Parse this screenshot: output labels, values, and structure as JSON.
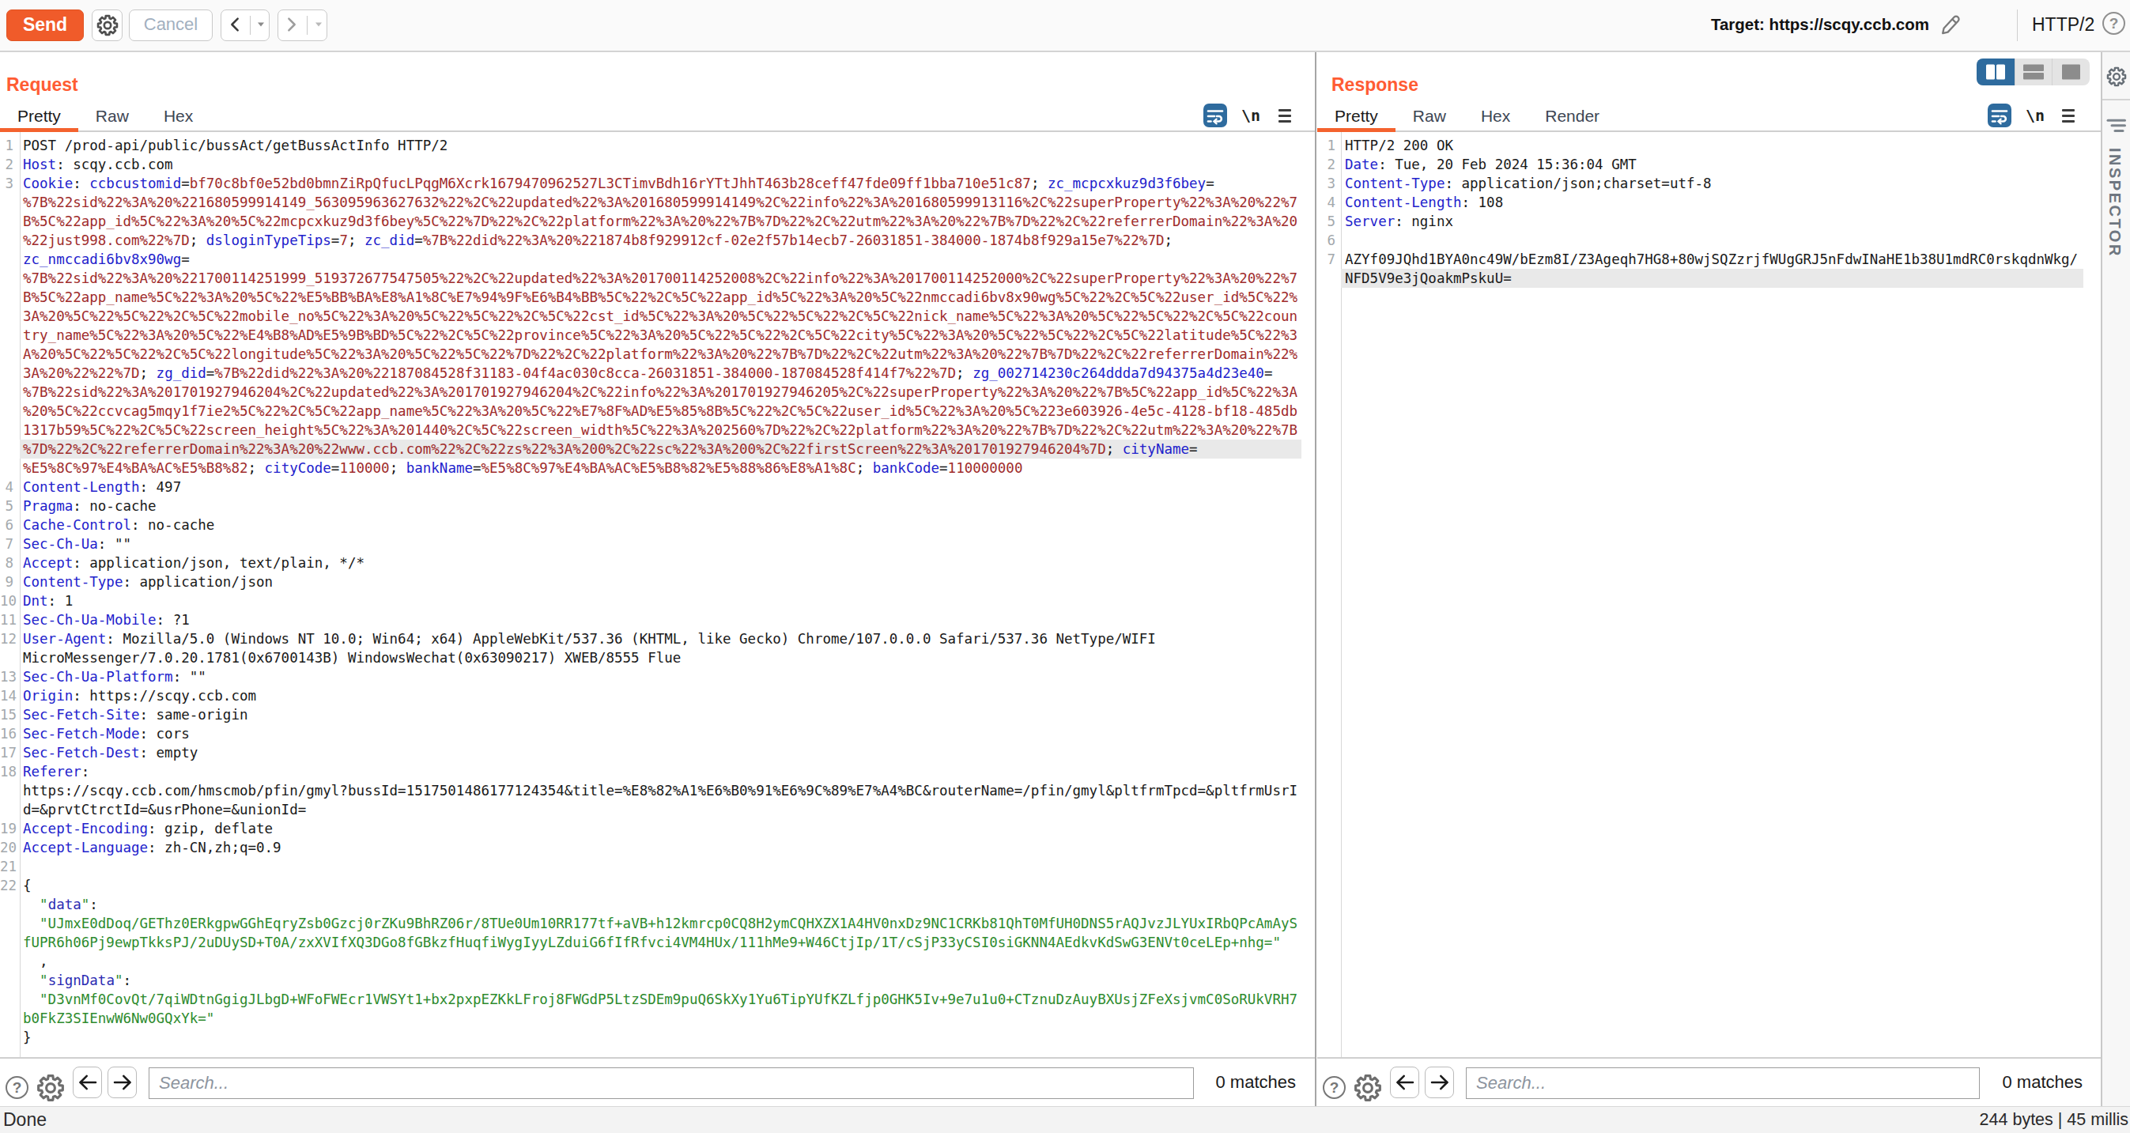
{
  "toolbar": {
    "send_label": "Send",
    "cancel_label": "Cancel",
    "target_label": "Target:",
    "target_url": "https://scqy.ccb.com",
    "protocol": "HTTP/2"
  },
  "request": {
    "title": "Request",
    "tabs": [
      "Pretty",
      "Raw",
      "Hex"
    ],
    "active_tab": "Pretty",
    "newline_label": "\\n",
    "search_placeholder": "Search...",
    "match_count": "0 matches",
    "rows": [
      {
        "n": "1",
        "s": [
          [
            "k",
            "POST /prod-api/public/bussAct/getBussActInfo HTTP/2"
          ]
        ]
      },
      {
        "n": "2",
        "s": [
          [
            "b",
            "Host"
          ],
          [
            "k",
            ": scqy.ccb.com"
          ]
        ]
      },
      {
        "n": "3",
        "s": [
          [
            "b",
            "Cookie"
          ],
          [
            "k",
            ": "
          ],
          [
            "b",
            "ccbcustomid"
          ],
          [
            "k",
            "="
          ],
          [
            "r",
            "bf70c8bf0e52bd0bmnZiRpQfucLPqgM6Xcrk1679470962527L3CTimvBdh16rYTtJhhT463b28ceff47fde09ff1bba710e51c87"
          ],
          [
            "k",
            "; "
          ],
          [
            "b",
            "zc_mcpcxkuz9d3f6bey"
          ],
          [
            "k",
            "="
          ]
        ]
      },
      {
        "s": [
          [
            "r",
            "%7B%22sid%22%3A%20%221680599914149_563095963627632%22%2C%22updated%22%3A%201680599914149%2C%22info%22%3A%201680599913116%2C%22superProperty%22%3A%20%22%7"
          ]
        ]
      },
      {
        "s": [
          [
            "r",
            "B%5C%22app_id%5C%22%3A%20%5C%22mcpcxkuz9d3f6bey%5C%22%7D%22%2C%22platform%22%3A%20%22%7B%7D%22%2C%22utm%22%3A%20%22%7B%7D%22%2C%22referrerDomain%22%3A%20"
          ]
        ]
      },
      {
        "s": [
          [
            "r",
            "%22just998.com%22%7D"
          ],
          [
            "k",
            "; "
          ],
          [
            "b",
            "dsloginTypeTips"
          ],
          [
            "k",
            "="
          ],
          [
            "r",
            "7"
          ],
          [
            "k",
            "; "
          ],
          [
            "b",
            "zc_did"
          ],
          [
            "k",
            "="
          ],
          [
            "r",
            "%7B%22did%22%3A%20%221874b8f929912cf-02e2f57b14ecb7-26031851-384000-1874b8f929a15e7%22%7D"
          ],
          [
            "k",
            ";"
          ]
        ]
      },
      {
        "s": [
          [
            "b",
            "zc_nmccadi6bv8x90wg"
          ],
          [
            "k",
            "="
          ]
        ]
      },
      {
        "s": [
          [
            "r",
            "%7B%22sid%22%3A%20%221700114251999_519372677547505%22%2C%22updated%22%3A%201700114252008%2C%22info%22%3A%201700114252000%2C%22superProperty%22%3A%20%22%7"
          ]
        ]
      },
      {
        "s": [
          [
            "r",
            "B%5C%22app_name%5C%22%3A%20%5C%22%E5%BB%BA%E8%A1%8C%E7%94%9F%E6%B4%BB%5C%22%2C%5C%22app_id%5C%22%3A%20%5C%22nmccadi6bv8x90wg%5C%22%2C%5C%22user_id%5C%22%"
          ]
        ]
      },
      {
        "s": [
          [
            "r",
            "3A%20%5C%22%5C%22%2C%5C%22mobile_no%5C%22%3A%20%5C%22%5C%22%2C%5C%22cst_id%5C%22%3A%20%5C%22%5C%22%2C%5C%22nick_name%5C%22%3A%20%5C%22%5C%22%2C%5C%22coun"
          ]
        ]
      },
      {
        "s": [
          [
            "r",
            "try_name%5C%22%3A%20%5C%22%E4%B8%AD%E5%9B%BD%5C%22%2C%5C%22province%5C%22%3A%20%5C%22%5C%22%2C%5C%22city%5C%22%3A%20%5C%22%5C%22%2C%5C%22latitude%5C%22%3"
          ]
        ]
      },
      {
        "s": [
          [
            "r",
            "A%20%5C%22%5C%22%2C%5C%22longitude%5C%22%3A%20%5C%22%5C%22%7D%22%2C%22platform%22%3A%20%22%7B%7D%22%2C%22utm%22%3A%20%22%7B%7D%22%2C%22referrerDomain%22%"
          ]
        ]
      },
      {
        "s": [
          [
            "r",
            "3A%20%22%22%7D"
          ],
          [
            "k",
            "; "
          ],
          [
            "b",
            "zg_did"
          ],
          [
            "k",
            "="
          ],
          [
            "r",
            "%7B%22did%22%3A%20%22187084528f31183-04f4ac030c8cca-26031851-384000-187084528f414f7%22%7D"
          ],
          [
            "k",
            "; "
          ],
          [
            "b",
            "zg_002714230c264ddda7d94375a4d23e40"
          ],
          [
            "k",
            "="
          ]
        ]
      },
      {
        "s": [
          [
            "r",
            "%7B%22sid%22%3A%201701927946204%2C%22updated%22%3A%201701927946204%2C%22info%22%3A%201701927946205%2C%22superProperty%22%3A%20%22%7B%5C%22app_id%5C%22%3A"
          ]
        ]
      },
      {
        "s": [
          [
            "r",
            "%20%5C%22ccvcag5mqy1f7ie2%5C%22%2C%5C%22app_name%5C%22%3A%20%5C%22%E7%8F%AD%E5%85%8B%5C%22%2C%5C%22user_id%5C%22%3A%20%5C%223e603926-4e5c-4128-bf18-485db"
          ]
        ]
      },
      {
        "s": [
          [
            "r",
            "1317b59%5C%22%2C%5C%22screen_height%5C%22%3A%201440%2C%5C%22screen_width%5C%22%3A%202560%7D%22%2C%22platform%22%3A%20%22%7B%7D%22%2C%22utm%22%3A%20%22%7B"
          ]
        ]
      },
      {
        "hl": true,
        "s": [
          [
            "r",
            "%7D%22%2C%22referrerDomain%22%3A%20%22www.ccb.com%22%2C%22zs%22%3A%200%2C%22sc%22%3A%200%2C%22firstScreen%22%3A%201701927946204%7D"
          ],
          [
            "k",
            "; "
          ],
          [
            "b",
            "cityName"
          ],
          [
            "k",
            "="
          ]
        ]
      },
      {
        "s": [
          [
            "r",
            "%E5%8C%97%E4%BA%AC%E5%B8%82"
          ],
          [
            "k",
            "; "
          ],
          [
            "b",
            "cityCode"
          ],
          [
            "k",
            "="
          ],
          [
            "r",
            "110000"
          ],
          [
            "k",
            "; "
          ],
          [
            "b",
            "bankName"
          ],
          [
            "k",
            "="
          ],
          [
            "r",
            "%E5%8C%97%E4%BA%AC%E5%B8%82%E5%88%86%E8%A1%8C"
          ],
          [
            "k",
            "; "
          ],
          [
            "b",
            "bankCode"
          ],
          [
            "k",
            "="
          ],
          [
            "r",
            "110000000"
          ]
        ]
      },
      {
        "n": "4",
        "s": [
          [
            "b",
            "Content-Length"
          ],
          [
            "k",
            ": 497"
          ]
        ]
      },
      {
        "n": "5",
        "s": [
          [
            "b",
            "Pragma"
          ],
          [
            "k",
            ": no-cache"
          ]
        ]
      },
      {
        "n": "6",
        "s": [
          [
            "b",
            "Cache-Control"
          ],
          [
            "k",
            ": no-cache"
          ]
        ]
      },
      {
        "n": "7",
        "s": [
          [
            "b",
            "Sec-Ch-Ua"
          ],
          [
            "k",
            ": \"\""
          ]
        ]
      },
      {
        "n": "8",
        "s": [
          [
            "b",
            "Accept"
          ],
          [
            "k",
            ": application/json, text/plain, */*"
          ]
        ]
      },
      {
        "n": "9",
        "s": [
          [
            "b",
            "Content-Type"
          ],
          [
            "k",
            ": application/json"
          ]
        ]
      },
      {
        "n": "10",
        "s": [
          [
            "b",
            "Dnt"
          ],
          [
            "k",
            ": 1"
          ]
        ]
      },
      {
        "n": "11",
        "s": [
          [
            "b",
            "Sec-Ch-Ua-Mobile"
          ],
          [
            "k",
            ": ?1"
          ]
        ]
      },
      {
        "n": "12",
        "s": [
          [
            "b",
            "User-Agent"
          ],
          [
            "k",
            ": Mozilla/5.0 (Windows NT 10.0; Win64; x64) AppleWebKit/537.36 (KHTML, like Gecko) Chrome/107.0.0.0 Safari/537.36 NetType/WIFI"
          ]
        ]
      },
      {
        "s": [
          [
            "k",
            "MicroMessenger/7.0.20.1781(0x6700143B) WindowsWechat(0x63090217) XWEB/8555 Flue"
          ]
        ]
      },
      {
        "n": "13",
        "s": [
          [
            "b",
            "Sec-Ch-Ua-Platform"
          ],
          [
            "k",
            ": \"\""
          ]
        ]
      },
      {
        "n": "14",
        "s": [
          [
            "b",
            "Origin"
          ],
          [
            "k",
            ": https://scqy.ccb.com"
          ]
        ]
      },
      {
        "n": "15",
        "s": [
          [
            "b",
            "Sec-Fetch-Site"
          ],
          [
            "k",
            ": same-origin"
          ]
        ]
      },
      {
        "n": "16",
        "s": [
          [
            "b",
            "Sec-Fetch-Mode"
          ],
          [
            "k",
            ": cors"
          ]
        ]
      },
      {
        "n": "17",
        "s": [
          [
            "b",
            "Sec-Fetch-Dest"
          ],
          [
            "k",
            ": empty"
          ]
        ]
      },
      {
        "n": "18",
        "s": [
          [
            "b",
            "Referer"
          ],
          [
            "k",
            ":"
          ]
        ]
      },
      {
        "s": [
          [
            "k",
            "https://scqy.ccb.com/hmscmob/pfin/gmyl?bussId=1517501486177124354&title=%E8%82%A1%E6%B0%91%E6%9C%89%E7%A4%BC&routerName=/pfin/gmyl&pltfrmTpcd=&pltfrmUsrI"
          ]
        ]
      },
      {
        "s": [
          [
            "k",
            "d=&prvtCtrctId=&usrPhone=&unionId="
          ]
        ]
      },
      {
        "n": "19",
        "s": [
          [
            "b",
            "Accept-Encoding"
          ],
          [
            "k",
            ": gzip, deflate"
          ]
        ]
      },
      {
        "n": "20",
        "s": [
          [
            "b",
            "Accept-Language"
          ],
          [
            "k",
            ": zh-CN,zh;q=0.9"
          ]
        ]
      },
      {
        "n": "21",
        "s": []
      },
      {
        "n": "22",
        "s": [
          [
            "k",
            "{"
          ]
        ]
      },
      {
        "s": [
          [
            "k",
            "  "
          ],
          [
            "g",
            "\""
          ],
          [
            "j",
            "data"
          ],
          [
            "g",
            "\""
          ],
          [
            "k",
            ":"
          ]
        ]
      },
      {
        "s": [
          [
            "k",
            "  "
          ],
          [
            "g",
            "\"UJmxE0dDoq/GEThz0ERkgpwGGhEqryZsb0Gzcj0rZKu9BhRZ06r/8TUe0Um10RR177tf+aVB+h12kmrcp0CQ8H2ymCQHXZX1A4HV0nxDz9NC1CRKb81QhT0MfUH0DNS5rAQJvzJLYUxIRbQPcAmAyS"
          ]
        ]
      },
      {
        "s": [
          [
            "g",
            "fUPR6h06Pj9ewpTkksPJ/2uDUySD+T0A/zxXVIfXQ3DGo8fGBkzfHuqfiWygIyyLZduiG6fIfRfvci4VM4HUx/111hMe9+W46CtjIp/1T/cSjP33yCSI0siGKNN4AEdkvKdSwG3ENVt0ceLEp+nhg=\""
          ]
        ]
      },
      {
        "s": [
          [
            "k",
            "  ,"
          ]
        ]
      },
      {
        "s": [
          [
            "k",
            "  "
          ],
          [
            "g",
            "\""
          ],
          [
            "j",
            "signData"
          ],
          [
            "g",
            "\""
          ],
          [
            "k",
            ":"
          ]
        ]
      },
      {
        "s": [
          [
            "k",
            "  "
          ],
          [
            "g",
            "\"D3vnMf0CovQt/7qiWDtnGgigJLbgD+WFoFWEcr1VWSYt1+bx2pxpEZKkLFroj8FWGdP5LtzSDEm9puQ6SkXy1Yu6TipYUfKZLfjp0GHK5Iv+9e7u1u0+CTznuDzAuyBXUsjZFeXsjvmC0SoRUkVRH7"
          ]
        ]
      },
      {
        "s": [
          [
            "g",
            "b0FkZ3SIEnwW6Nw0GQxYk=\""
          ]
        ]
      },
      {
        "s": [
          [
            "k",
            "}"
          ]
        ]
      }
    ]
  },
  "response": {
    "title": "Response",
    "tabs": [
      "Pretty",
      "Raw",
      "Hex",
      "Render"
    ],
    "active_tab": "Pretty",
    "newline_label": "\\n",
    "search_placeholder": "Search...",
    "match_count": "0 matches",
    "rows": [
      {
        "n": "1",
        "s": [
          [
            "k",
            "HTTP/2 200 OK"
          ]
        ]
      },
      {
        "n": "2",
        "s": [
          [
            "b",
            "Date"
          ],
          [
            "k",
            ": Tue, 20 Feb 2024 15:36:04 GMT"
          ]
        ]
      },
      {
        "n": "3",
        "s": [
          [
            "b",
            "Content-Type"
          ],
          [
            "k",
            ": application/json;charset=utf-8"
          ]
        ]
      },
      {
        "n": "4",
        "s": [
          [
            "b",
            "Content-Length"
          ],
          [
            "k",
            ": 108"
          ]
        ]
      },
      {
        "n": "5",
        "s": [
          [
            "b",
            "Server"
          ],
          [
            "k",
            ": nginx"
          ]
        ]
      },
      {
        "n": "6",
        "s": []
      },
      {
        "n": "7",
        "s": [
          [
            "k",
            "AZYf09JQhd1BYA0nc49W/bEzm8I/Z3Ageqh7HG8+80wjSQZzrjfWUgGRJ5nFdwINaHE1b38U1mdRC0rskqdnWkg/"
          ]
        ]
      },
      {
        "hl": true,
        "s": [
          [
            "k",
            "NFD5V9e3jQoakmPskuU="
          ]
        ]
      }
    ]
  },
  "inspector": {
    "label": "INSPECTOR"
  },
  "statusbar": {
    "left": "Done",
    "right": "244 bytes | 45 millis"
  },
  "icons": {
    "help_glyph": "?"
  },
  "colors": {
    "accent_orange": "#ff6633",
    "selected_blue": "#2e6b9e",
    "header_blue": "#2222cc",
    "value_red": "#a02c2c",
    "string_green": "#2e8b2e",
    "json_key_navy": "#2b2bb2"
  }
}
